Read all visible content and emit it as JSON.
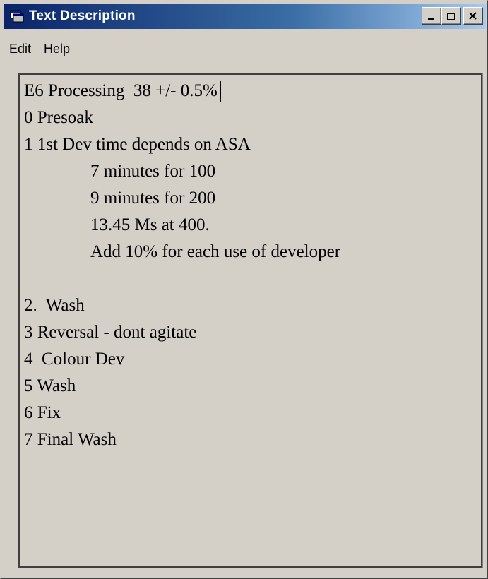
{
  "window": {
    "title": "Text Description",
    "icon": "app-window-icon"
  },
  "caption_buttons": {
    "minimize_icon": "minimize-icon",
    "maximize_icon": "maximize-icon",
    "close_icon": "close-icon"
  },
  "menu": {
    "items": [
      "Edit",
      "Help"
    ]
  },
  "text": {
    "lines": [
      "E6 Processing  38 +/- 0.5%",
      "0 Presoak",
      "1 1st Dev time depends on ASA",
      "7 minutes for 100",
      "9 minutes for 200",
      "13.45 Ms at 400.",
      "Add 10% for each use of developer",
      "",
      "2.  Wash",
      "3 Reversal - dont agitate",
      "4  Colour Dev",
      "5 Wash",
      "6 Fix",
      "7 Final Wash"
    ]
  },
  "colors": {
    "title_bar_start": "#0a246a",
    "title_bar_end": "#a6caf0",
    "face": "#d4d0c8"
  }
}
